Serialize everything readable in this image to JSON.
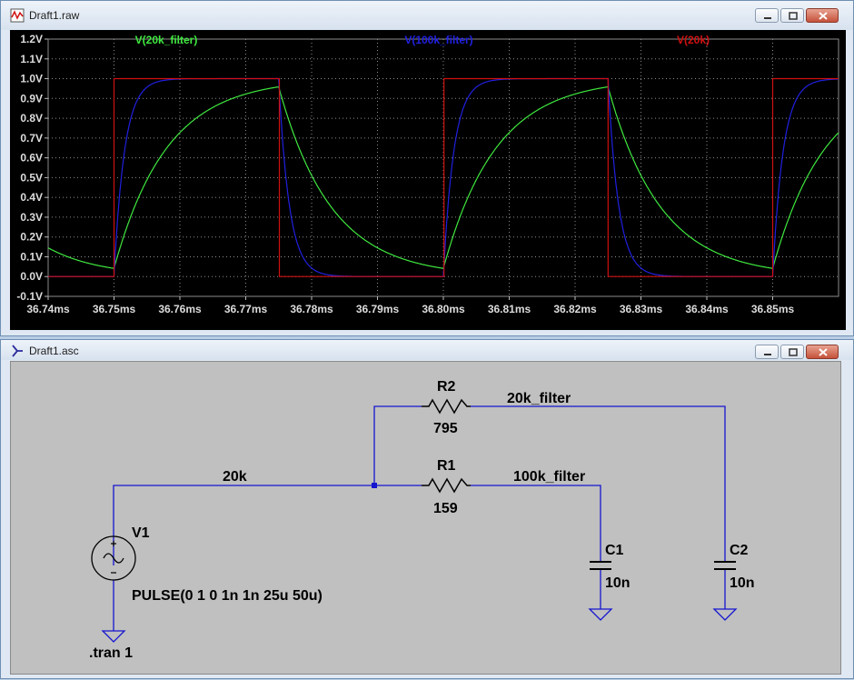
{
  "windows": {
    "raw": {
      "title": "Draft1.raw"
    },
    "asc": {
      "title": "Draft1.asc"
    }
  },
  "colors": {
    "trace_green": "#3fe83f",
    "trace_blue": "#2020e0",
    "trace_red": "#d01010",
    "grid": "#8c8c8c",
    "wire": "#1515d0"
  },
  "chart_data": {
    "type": "line",
    "x": [
      36.74,
      36.75,
      36.76,
      36.77,
      36.78,
      36.79,
      36.8,
      36.81,
      36.82,
      36.83,
      36.84,
      36.85,
      36.86
    ],
    "xlim": [
      36.74,
      36.86
    ],
    "ylim": [
      -0.1,
      1.2
    ],
    "x_ticks": [
      "36.74ms",
      "36.75ms",
      "36.76ms",
      "36.77ms",
      "36.78ms",
      "36.79ms",
      "36.80ms",
      "36.81ms",
      "36.82ms",
      "36.83ms",
      "36.84ms",
      "36.85ms"
    ],
    "y_ticks": [
      "1.2V",
      "1.1V",
      "1.0V",
      "0.9V",
      "0.8V",
      "0.7V",
      "0.6V",
      "0.5V",
      "0.4V",
      "0.3V",
      "0.2V",
      "0.1V",
      "0.0V",
      "-0.1V"
    ],
    "grid": true,
    "legend": "top",
    "series": [
      {
        "name": "V(20k_filter)",
        "color": "#3fe83f",
        "values": [
          0.15,
          0.05,
          0.58,
          0.83,
          0.5,
          0.22,
          0.05,
          0.58,
          0.83,
          0.52,
          0.22,
          0.05,
          0.72
        ]
      },
      {
        "name": "V(100k_filter)",
        "color": "#2020e0",
        "values": [
          0.0,
          0.0,
          1.0,
          1.0,
          0.0,
          0.0,
          0.0,
          1.0,
          1.0,
          0.0,
          0.0,
          0.0,
          1.0
        ]
      },
      {
        "name": "V(20k)",
        "color": "#d01010",
        "values": [
          0.0,
          1.0,
          1.0,
          1.0,
          0.0,
          0.0,
          1.0,
          1.0,
          1.0,
          0.0,
          0.0,
          1.0,
          1.0
        ]
      }
    ]
  },
  "schematic": {
    "labels": {
      "r2_name": "R2",
      "r2_value": "795",
      "r1_name": "R1",
      "r1_value": "159",
      "net_20k_filter": "20k_filter",
      "net_100k_filter": "100k_filter",
      "net_20k": "20k",
      "c1_name": "C1",
      "c1_value": "10n",
      "c2_name": "C2",
      "c2_value": "10n",
      "v1_name": "V1",
      "v1_value": "PULSE(0 1 0 1n 1n 25u 50u)",
      "directive": ".tran 1"
    }
  }
}
